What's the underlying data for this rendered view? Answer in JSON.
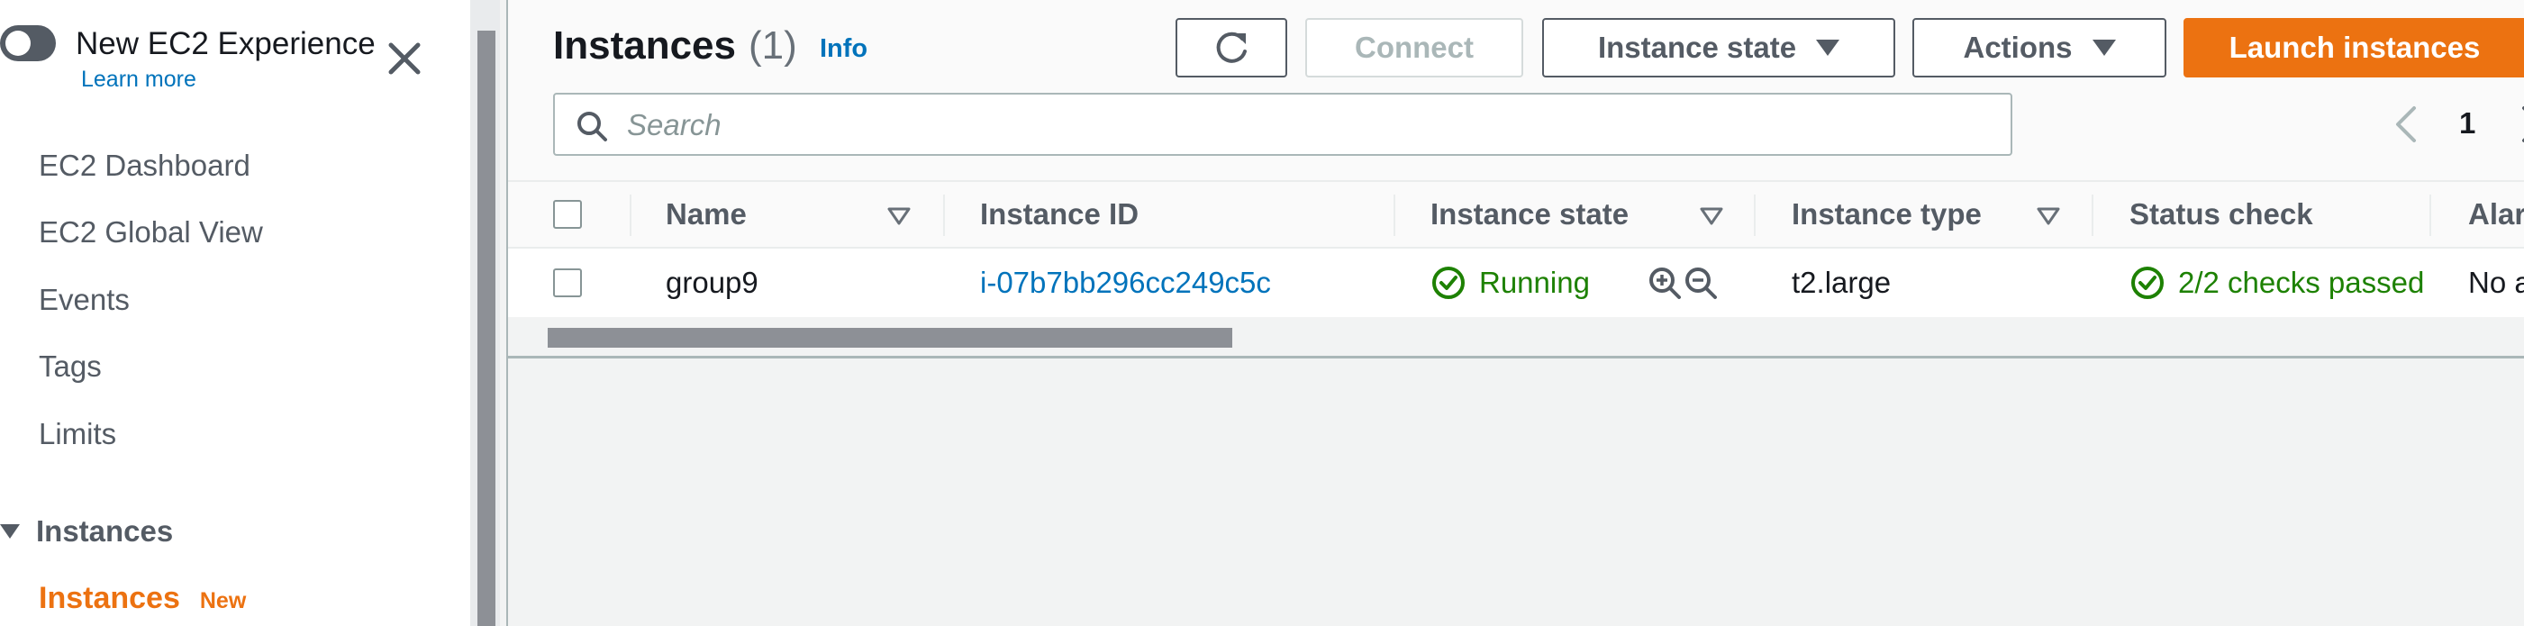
{
  "sidebar": {
    "experience_title": "New EC2 Experience",
    "learn_more": "Learn more",
    "items": [
      {
        "label": "EC2 Dashboard"
      },
      {
        "label": "EC2 Global View"
      },
      {
        "label": "Events"
      },
      {
        "label": "Tags"
      },
      {
        "label": "Limits"
      }
    ],
    "section": "Instances",
    "active_item": {
      "label": "Instances",
      "badge": "New"
    }
  },
  "header": {
    "title": "Instances",
    "count": "(1)",
    "info": "Info",
    "buttons": {
      "connect": "Connect",
      "instance_state": "Instance state",
      "actions": "Actions",
      "launch": "Launch instances"
    }
  },
  "search": {
    "placeholder": "Search",
    "value": ""
  },
  "pagination": {
    "current": "1"
  },
  "table": {
    "columns": [
      "Name",
      "Instance ID",
      "Instance state",
      "Instance type",
      "Status check",
      "Alar"
    ],
    "rows": [
      {
        "name": "group9",
        "instance_id": "i-07b7bb296cc249c5c",
        "state": "Running",
        "type": "t2.large",
        "status_check": "2/2 checks passed",
        "alarm": "No a"
      }
    ]
  },
  "colors": {
    "accent": "#ec7211",
    "link": "#0073bb",
    "success": "#1d8102"
  }
}
